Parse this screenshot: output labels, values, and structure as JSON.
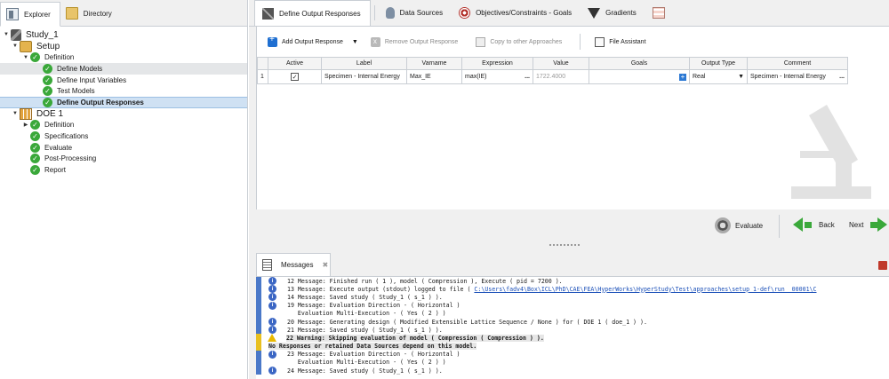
{
  "left_tabs": [
    {
      "label": "Explorer",
      "icon": "explorer-icon"
    },
    {
      "label": "Directory",
      "icon": "directory-icon"
    }
  ],
  "tree": {
    "study": "Study_1",
    "setup": "Setup",
    "setup_definition": "Definition",
    "define_models": "Define Models",
    "define_input_variables": "Define Input Variables",
    "test_models": "Test Models",
    "define_output_responses": "Define Output Responses",
    "doe": "DOE 1",
    "doe_definition": "Definition",
    "specifications": "Specifications",
    "evaluate": "Evaluate",
    "post_processing": "Post-Processing",
    "report": "Report"
  },
  "right_tabs": [
    {
      "label": "Define Output Responses",
      "icon": "output-responses-icon"
    },
    {
      "label": "Data Sources",
      "icon": "database-icon"
    },
    {
      "label": "Objectives/Constraints - Goals",
      "icon": "target-icon"
    },
    {
      "label": "Gradients",
      "icon": "nabla-icon"
    }
  ],
  "toolbar": {
    "add": "Add Output Response",
    "remove": "Remove Output Response",
    "copy": "Copy to other Approaches",
    "file_assistant": "File Assistant"
  },
  "grid": {
    "columns": [
      "Active",
      "Label",
      "Varname",
      "Expression",
      "Value",
      "Goals",
      "Output Type",
      "Comment"
    ],
    "rows": [
      {
        "index": "1",
        "active": true,
        "label": "Specimen - Internal Energy",
        "varname": "Max_IE",
        "expression": "max(IE)",
        "value": "1722.4000",
        "goals": "",
        "output_type": "Real",
        "comment": "Specimen - Internal Energy"
      }
    ]
  },
  "actions": {
    "evaluate": "Evaluate",
    "back": "Back",
    "next": "Next"
  },
  "messages_tab": "Messages",
  "messages": [
    {
      "type": "info",
      "text": "12 Message: Finished run ( 1 ), model ( Compression ), Execute ( pid = 7200 )."
    },
    {
      "type": "info",
      "text": "13 Message: Execute output (stdout) logged to file ( ",
      "link": "C:\\Users\\fadv4\\Box\\ICL\\PhD\\CAE\\FEA\\HyperWorks\\HyperStudy\\Test\\approaches\\setup_1-def\\run__00001\\C"
    },
    {
      "type": "info",
      "text": "14 Message: Saved study ( Study_1 ( s_1 ) )."
    },
    {
      "type": "info",
      "text": "19 Message: Evaluation Direction - ( Horizontal )"
    },
    {
      "type": "cont",
      "text": "   Evaluation Multi-Execution - ( Yes ( 2 ) )"
    },
    {
      "type": "info",
      "text": "20 Message: Generating design ( Modified Extensible Lattice Sequence / None ) for ( DOE 1 ( doe_1 ) )."
    },
    {
      "type": "info",
      "text": "21 Message: Saved study ( Study_1 ( s_1 ) )."
    },
    {
      "type": "warn",
      "text": "22 Warning: Skipping evaluation of model ( Compression ( Compression ) )."
    },
    {
      "type": "warncont",
      "text": "No Responses or retained Data Sources depend on this model."
    },
    {
      "type": "info",
      "text": "23 Message: Evaluation Direction - ( Horizontal )"
    },
    {
      "type": "cont",
      "text": "   Evaluation Multi-Execution - ( Yes ( 2 ) )"
    },
    {
      "type": "info",
      "text": "24 Message: Saved study ( Study_1 ( s_1 ) )."
    }
  ],
  "colors": {
    "check_green": "#3aa83a",
    "selection_blue": "#cfe1f3",
    "info_blue": "#3b66c4",
    "warning_yellow": "#e8c020"
  }
}
